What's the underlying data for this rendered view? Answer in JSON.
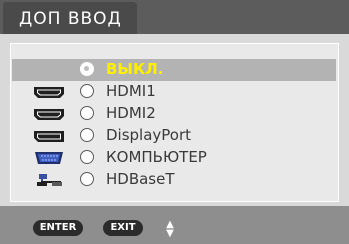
{
  "title": "ДОП ВВОД",
  "options": [
    {
      "label": "ВЫКЛ.",
      "icon": "none",
      "selected": true
    },
    {
      "label": "HDMI1",
      "icon": "hdmi-icon",
      "selected": false
    },
    {
      "label": "HDMI2",
      "icon": "hdmi-icon",
      "selected": false
    },
    {
      "label": "DisplayPort",
      "icon": "displayport-icon",
      "selected": false
    },
    {
      "label": "КОМПЬЮТЕР",
      "icon": "vga-icon",
      "selected": false
    },
    {
      "label": "HDBaseT",
      "icon": "network-icon",
      "selected": false
    }
  ],
  "footer": {
    "enter_label": "ENTER",
    "exit_label": "EXIT",
    "updown_icon": "up-down-arrows-icon"
  },
  "colors": {
    "selected_text": "#ffee00",
    "selected_row": "#b3b3b3",
    "title_bar": "#5c5c5c",
    "footer_bar": "#8e8e8e"
  }
}
